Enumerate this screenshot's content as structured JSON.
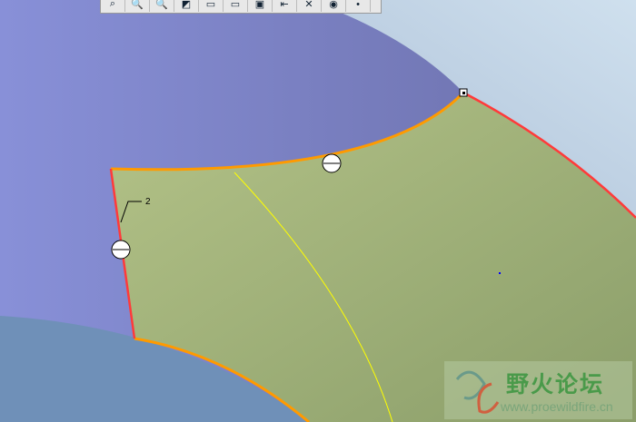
{
  "toolbar": {
    "buttons": [
      {
        "name": "zoom-window-icon",
        "glyph": "⌕"
      },
      {
        "name": "zoom-in-icon",
        "glyph": "🔍"
      },
      {
        "name": "zoom-out-icon",
        "glyph": "🔍"
      },
      {
        "name": "refit-icon",
        "glyph": "◩"
      },
      {
        "name": "reorient-icon",
        "glyph": "▭"
      },
      {
        "name": "view-list-icon",
        "glyph": "▭"
      },
      {
        "name": "saved-views-icon",
        "glyph": "▣"
      },
      {
        "name": "layers-icon",
        "glyph": "⇤"
      },
      {
        "name": "datum-axes-icon",
        "glyph": "✕"
      },
      {
        "name": "display-icon",
        "glyph": "◉"
      },
      {
        "name": "datum-points-icon",
        "glyph": "•"
      }
    ]
  },
  "model": {
    "dimension_label": "2"
  },
  "watermark": {
    "title": "野火论坛",
    "url": "www.proewildfire.cn"
  },
  "colors": {
    "edge_red": "#ff3a3a",
    "edge_orange": "#ff9a00",
    "face": "#a9b97e",
    "datum_curve": "#ffff00"
  }
}
